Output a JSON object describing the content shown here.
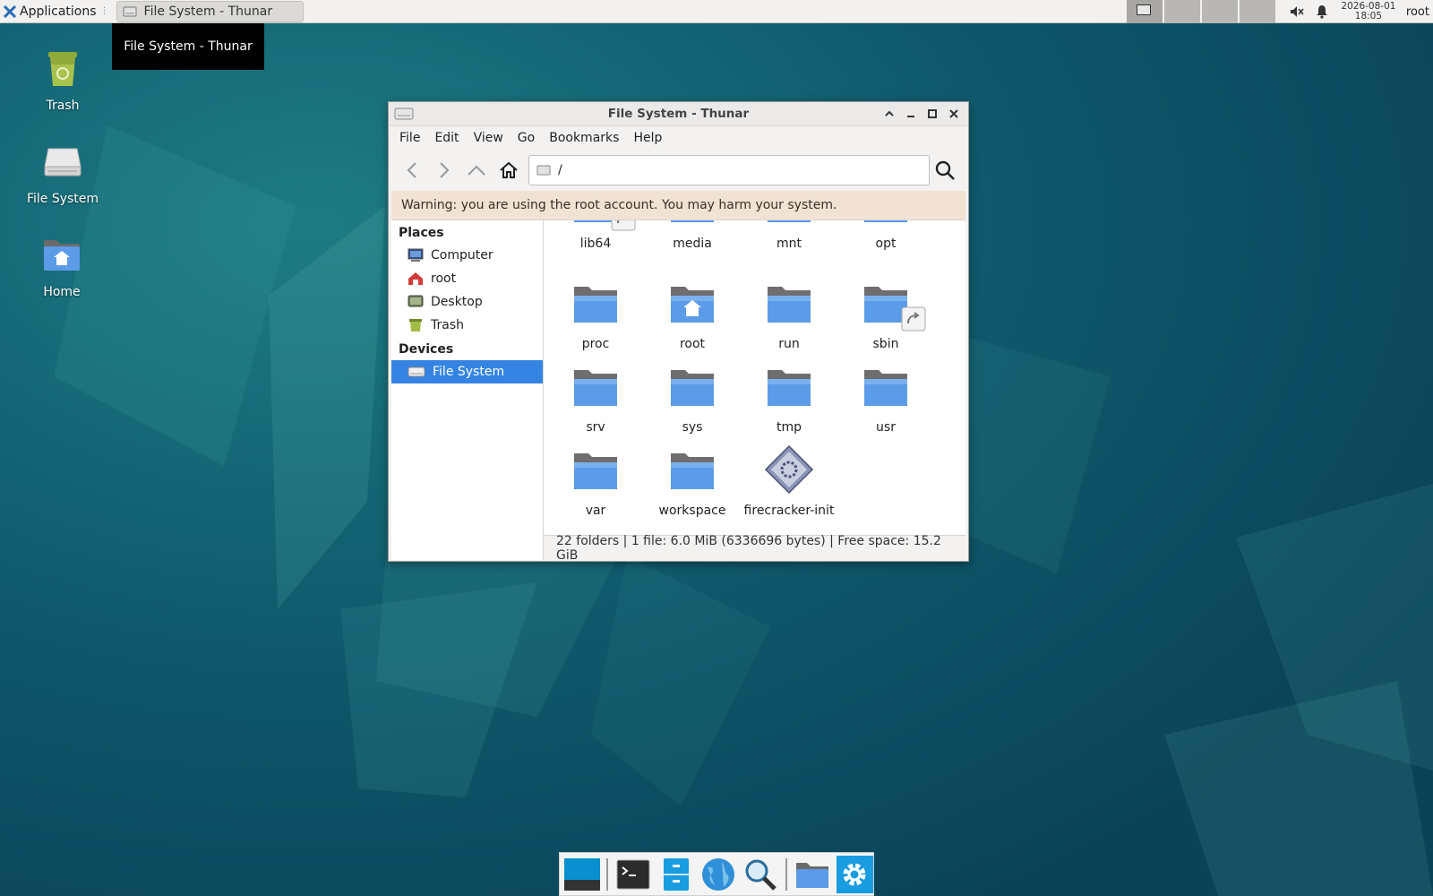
{
  "panel": {
    "applications_label": "Applications",
    "task_title": "File System - Thunar",
    "clock_date": "2026-08-01",
    "clock_time": "18:05",
    "user": "root"
  },
  "tooltip": {
    "text": "File System - Thunar"
  },
  "desktop": {
    "icons": [
      {
        "label": "Trash",
        "icon": "trash-icon"
      },
      {
        "label": "File System",
        "icon": "drive-icon"
      },
      {
        "label": "Home",
        "icon": "home-folder-icon"
      }
    ]
  },
  "window": {
    "title": "File System - Thunar",
    "menu": [
      "File",
      "Edit",
      "View",
      "Go",
      "Bookmarks",
      "Help"
    ],
    "location": "/",
    "warning": "Warning: you are using the root account. You may harm your system.",
    "sidebar": {
      "places_heading": "Places",
      "places": [
        "Computer",
        "root",
        "Desktop",
        "Trash"
      ],
      "devices_heading": "Devices",
      "devices": [
        "File System"
      ],
      "selected": "File System"
    },
    "files": [
      {
        "name": "lib64",
        "type": "folder-link"
      },
      {
        "name": "media",
        "type": "folder"
      },
      {
        "name": "mnt",
        "type": "folder"
      },
      {
        "name": "opt",
        "type": "folder"
      },
      {
        "name": "proc",
        "type": "folder"
      },
      {
        "name": "root",
        "type": "home-folder"
      },
      {
        "name": "run",
        "type": "folder"
      },
      {
        "name": "sbin",
        "type": "folder-link"
      },
      {
        "name": "srv",
        "type": "folder"
      },
      {
        "name": "sys",
        "type": "folder"
      },
      {
        "name": "tmp",
        "type": "folder"
      },
      {
        "name": "usr",
        "type": "folder"
      },
      {
        "name": "var",
        "type": "folder"
      },
      {
        "name": "workspace",
        "type": "folder"
      },
      {
        "name": "firecracker-init",
        "type": "executable"
      }
    ],
    "status": "22 folders  |  1 file: 6.0 MiB (6336696 bytes)  |  Free space: 15.2 GiB"
  },
  "colors": {
    "desktop_bg": "#0d4f63",
    "selection": "#3584e4",
    "folder_blue": "#5b9be8",
    "warning_bg": "#f1e2d4"
  }
}
